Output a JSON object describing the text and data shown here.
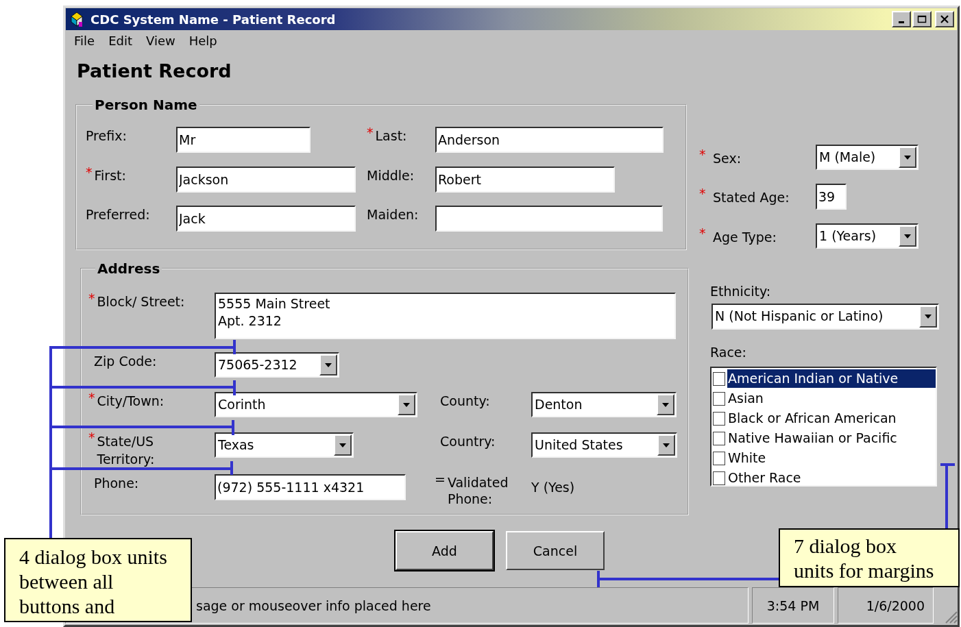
{
  "window": {
    "title": "CDC System Name - Patient Record"
  },
  "menu": [
    {
      "label": "File"
    },
    {
      "label": "Edit"
    },
    {
      "label": "View"
    },
    {
      "label": "Help"
    }
  ],
  "heading": "Patient Record",
  "person_name": {
    "title": "Person Name",
    "rows": [
      [
        {
          "label": "Prefix:",
          "kind": "text",
          "value": "Mr"
        },
        {
          "marker": {
            "text": "*",
            "color": "#e00000"
          },
          "label": "Last:",
          "kind": "text",
          "value": "Anderson"
        }
      ],
      [
        {
          "marker": {
            "text": "*",
            "color": "#e00000"
          },
          "label": "First:",
          "kind": "text",
          "value": "Jackson"
        },
        {
          "label": "Middle:",
          "kind": "text",
          "value": "Robert"
        }
      ],
      [
        {
          "label": "Preferred:",
          "kind": "text",
          "value": "Jack"
        },
        {
          "label": "Maiden:",
          "kind": "text"
        }
      ]
    ]
  },
  "demographics": [
    {
      "marker": {
        "text": "*",
        "color": "#e00000"
      },
      "label": "Sex:",
      "kind": "combo",
      "value": "M (Male)"
    },
    {
      "marker": {
        "text": "*",
        "color": "#e00000"
      },
      "label": "Stated Age:",
      "kind": "text",
      "value": "39"
    },
    {
      "marker": {
        "text": "*",
        "color": "#e00000"
      },
      "label": "Age Type:",
      "kind": "combo",
      "value": "1 (Years)"
    }
  ],
  "ethnicity": {
    "label": "Ethnicity:",
    "value": "N (Not Hispanic or Latino)"
  },
  "race": {
    "label": "Race:",
    "options": [
      {
        "label": "American Indian or Native",
        "checked": false,
        "selected": true
      },
      {
        "label": "Asian",
        "checked": false,
        "selected": false
      },
      {
        "label": "Black or African American",
        "checked": false,
        "selected": false
      },
      {
        "label": "Native Hawaiian or Pacific",
        "checked": false,
        "selected": false
      },
      {
        "label": "White",
        "checked": false,
        "selected": false
      },
      {
        "label": "Other Race",
        "checked": false,
        "selected": false
      }
    ]
  },
  "address": {
    "title": "Address",
    "rows": [
      [
        {
          "marker": {
            "text": "*",
            "color": "#e00000"
          },
          "label": "Block/ Street:",
          "kind": "multiline",
          "value": "5555 Main Street\nApt. 2312"
        }
      ],
      [
        {
          "label": "Zip Code:",
          "kind": "combo",
          "value": "75065-2312"
        }
      ],
      [
        {
          "marker": {
            "text": "*",
            "color": "#e00000"
          },
          "label": "City/Town:",
          "kind": "combo",
          "value": "Corinth"
        },
        {
          "label": "County:",
          "kind": "combo",
          "value": "Denton"
        }
      ],
      [
        {
          "marker": {
            "text": "*",
            "color": "#e00000"
          },
          "label": "State/US Territory:",
          "kind": "combo",
          "value": "Texas"
        },
        {
          "label": "Country:",
          "kind": "combo",
          "value": "United States"
        }
      ],
      [
        {
          "label": "Phone:",
          "kind": "text",
          "value": "(972) 555-1111 x4321"
        },
        {
          "marker": {
            "text": "=",
            "color": "#000000"
          },
          "label": "Validated Phone:",
          "kind": "static",
          "value": "Y (Yes)"
        }
      ]
    ]
  },
  "buttons": [
    {
      "label": "Add",
      "default": true
    },
    {
      "label": "Cancel",
      "default": false
    }
  ],
  "status_bar": {
    "message": "sage or mouseover info placed here",
    "time": "3:54 PM",
    "date": "1/6/2000"
  },
  "annotations": [
    {
      "text": "4 dialog box units between all buttons and"
    },
    {
      "text": "7 dialog box units for margins"
    }
  ]
}
